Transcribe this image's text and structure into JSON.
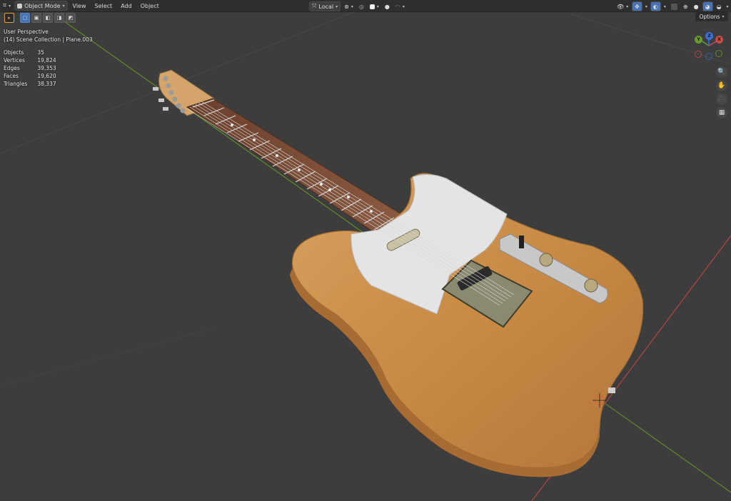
{
  "header": {
    "mode": "Object Mode",
    "menus": [
      "View",
      "Select",
      "Add",
      "Object"
    ],
    "transform_orientation": "Local",
    "options_label": "Options"
  },
  "overlay": {
    "view_name": "User Perspective",
    "collection_line": "(14) Scene Collection | Plane.003"
  },
  "stats": [
    {
      "label": "Objects",
      "value": "35"
    },
    {
      "label": "Vertices",
      "value": "19,824"
    },
    {
      "label": "Edges",
      "value": "39,353"
    },
    {
      "label": "Faces",
      "value": "19,620"
    },
    {
      "label": "Triangles",
      "value": "38,337"
    }
  ],
  "gizmo": {
    "x": "X",
    "y": "Y",
    "z": "Z"
  },
  "colors": {
    "header": "#2f2f2f",
    "viewport": "#3d3d3d",
    "x_axis": "#c94a4a",
    "y_axis": "#6a9a2a",
    "wood": "#c98c48",
    "pickguard": "#e4e4e4",
    "select": "#4772b3"
  },
  "icons": [
    "editor-type-icon",
    "object-mode-icon",
    "cursor-icon",
    "select-box-icon",
    "global-local-icon",
    "pivot-icon",
    "snap-icon",
    "proportional-icon",
    "visibility-icon",
    "gizmo-icon",
    "overlay-icon",
    "xray-icon",
    "wireframe-shading-icon",
    "solid-shading-icon",
    "material-shading-icon",
    "rendered-shading-icon",
    "zoom-icon",
    "pan-hand-icon",
    "camera-icon",
    "grid-ortho-icon"
  ]
}
